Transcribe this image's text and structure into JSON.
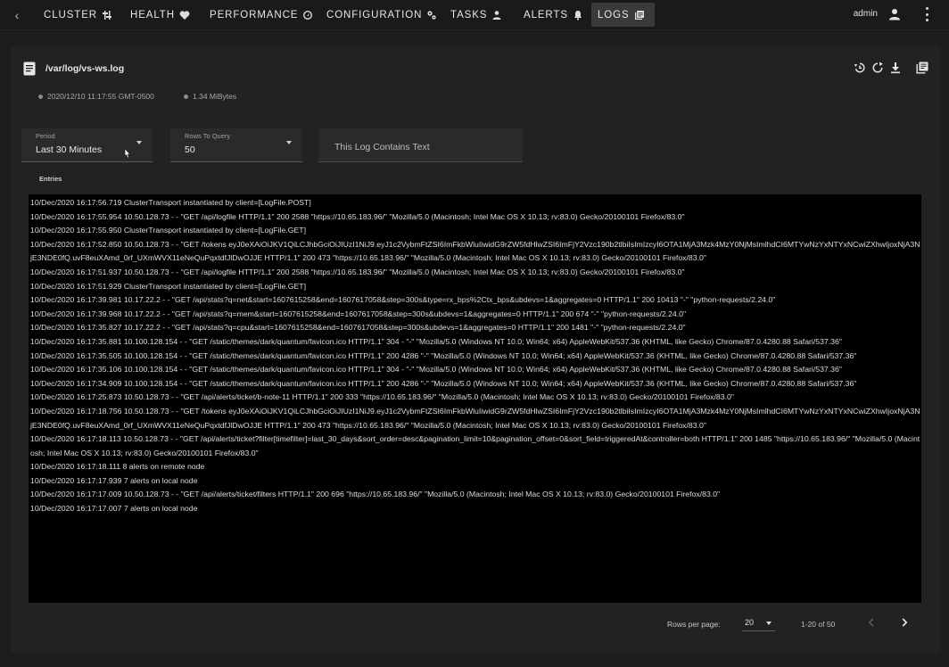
{
  "nav": {
    "items": [
      {
        "label": "CLUSTER",
        "icon": "cluster-icon"
      },
      {
        "label": "HEALTH",
        "icon": "heart-icon"
      },
      {
        "label": "PERFORMANCE",
        "icon": "speedometer-icon"
      },
      {
        "label": "CONFIGURATION",
        "icon": "gears-icon"
      },
      {
        "label": "TASKS",
        "icon": "task-person-icon"
      },
      {
        "label": "ALERTS",
        "icon": "bell-icon"
      },
      {
        "label": "LOGS",
        "icon": "logs-icon"
      }
    ],
    "active": "LOGS",
    "user": "admin"
  },
  "file": {
    "path": "/var/log/vs-ws.log",
    "timestamp": "2020/12/10 11:17:55 GMT-0500",
    "size": "1.34 MiBytes"
  },
  "filters": {
    "period_label": "Period",
    "period_value": "Last 30 Minutes",
    "rows_label": "Rows To Query",
    "rows_value": "50",
    "search_placeholder": "This Log Contains Text"
  },
  "entries_label": "Entries",
  "log_lines": [
    "10/Dec/2020 16:17:56.719 ClusterTransport instantiated by client=[LogFile.POST]",
    "10/Dec/2020 16:17:55.954 10.50.128.73 - - \"GET /api/logfile HTTP/1.1\" 200 2588 \"https://10.65.183.96/\" \"Mozilla/5.0 (Macintosh; Intel Mac OS X 10.13; rv:83.0) Gecko/20100101 Firefox/83.0\"",
    "10/Dec/2020 16:17:55.950 ClusterTransport instantiated by client=[LogFile.GET]",
    "10/Dec/2020 16:17:52.850 10.50.128.73 - - \"GET /tokens eyJ0eXAiOiJKV1QiLCJhbGciOiJIUzI1NiJ9.eyJ1c2VybmFtZSI6ImFkbWluIiwidG9rZW5fdHlwZSI6ImFjY2Vzc190b2tlbiIsImIzcyI6OTA1MjA3Mzk4MzY0NjMsImlhdCI6MTYwNzYxNTYxNCwiZXhwIjoxNjA3NjE3NDE0fQ.uvF8euXAmd_0rf_UXmWVX11eNeQuPqxtdfJlDwOJJE HTTP/1.1\" 200 473 \"https://10.65.183.96/\" \"Mozilla/5.0 (Macintosh; Intel Mac OS X 10.13; rv:83.0) Gecko/20100101 Firefox/83.0\"",
    "10/Dec/2020 16:17:51.937 10.50.128.73 - - \"GET /api/logfile HTTP/1.1\" 200 2588 \"https://10.65.183.96/\" \"Mozilla/5.0 (Macintosh; Intel Mac OS X 10.13; rv:83.0) Gecko/20100101 Firefox/83.0\"",
    "10/Dec/2020 16:17:51.929 ClusterTransport instantiated by client=[LogFile.GET]",
    "10/Dec/2020 16:17:39.981 10.17.22.2 - - \"GET /api/stats?q=net&start=1607615258&end=1607617058&step=300s&type=rx_bps%2Ctx_bps&ubdevs=1&aggregates=0 HTTP/1.1\" 200 10413 \"-\" \"python-requests/2.24.0\"",
    "10/Dec/2020 16:17:39.968 10.17.22.2 - - \"GET /api/stats?q=mem&start=1607615258&end=1607617058&step=300s&ubdevs=1&aggregates=0 HTTP/1.1\" 200 674 \"-\" \"python-requests/2.24.0\"",
    "10/Dec/2020 16:17:35.827 10.17.22.2 - - \"GET /api/stats?q=cpu&start=1607615258&end=1607617058&step=300s&ubdevs=1&aggregates=0 HTTP/1.1\" 200 1481 \"-\" \"python-requests/2.24.0\"",
    "10/Dec/2020 16:17:35.881 10.100.128.154 - - \"GET /static/themes/dark/quantum/favicon.ico HTTP/1.1\" 304 - \"-\" \"Mozilla/5.0 (Windows NT 10.0; Win64; x64) AppleWebKit/537.36 (KHTML, like Gecko) Chrome/87.0.4280.88 Safari/537.36\"",
    "10/Dec/2020 16:17:35.505 10.100.128.154 - - \"GET /static/themes/dark/quantum/favicon.ico HTTP/1.1\" 200 4286 \"-\" \"Mozilla/5.0 (Windows NT 10.0; Win64; x64) AppleWebKit/537.36 (KHTML, like Gecko) Chrome/87.0.4280.88 Safari/537.36\"",
    "10/Dec/2020 16:17:35.106 10.100.128.154 - - \"GET /static/themes/dark/quantum/favicon.ico HTTP/1.1\" 304 - \"-\" \"Mozilla/5.0 (Windows NT 10.0; Win64; x64) AppleWebKit/537.36 (KHTML, like Gecko) Chrome/87.0.4280.88 Safari/537.36\"",
    "10/Dec/2020 16:17:34.909 10.100.128.154 - - \"GET /static/themes/dark/quantum/favicon.ico HTTP/1.1\" 200 4286 \"-\" \"Mozilla/5.0 (Windows NT 10.0; Win64; x64) AppleWebKit/537.36 (KHTML, like Gecko) Chrome/87.0.4280.88 Safari/537.36\"",
    "10/Dec/2020 16:17:25.873 10.50.128.73 - - \"GET /api/alerts/ticket/b-note-11 HTTP/1.1\" 200 333 \"https://10.65.183.96/\" \"Mozilla/5.0 (Macintosh; Intel Mac OS X 10.13; rv:83.0) Gecko/20100101 Firefox/83.0\"",
    "10/Dec/2020 16:17:18.756 10.50.128.73 - - \"GET /tokens eyJ0eXAiOiJKV1QiLCJhbGciOiJIUzI1NiJ9.eyJ1c2VybmFtZSI6ImFkbWluIiwidG9rZW5fdHlwZSI6ImFjY2Vzc190b2tlbiIsImIzcyI6OTA1MjA3Mzk4MzY0NjMsImlhdCI6MTYwNzYxNTYxNCwiZXhwIjoxNjA3NjE3NDE0fQ.uvF8euXAmd_0rf_UXmWVX11eNeQuPqxtdfJlDwOJJE HTTP/1.1\" 200 473 \"https://10.65.183.96/\" \"Mozilla/5.0 (Macintosh; Intel Mac OS X 10.13; rv:83.0) Gecko/20100101 Firefox/83.0\"",
    "10/Dec/2020 16:17:18.113 10.50.128.73 - - \"GET /api/alerts/ticket?filter[timefilter]=last_30_days&sort_order=desc&pagination_limit=10&pagination_offset=0&sort_field=triggeredAt&controller=both HTTP/1.1\" 200 1485 \"https://10.65.183.96/\" \"Mozilla/5.0 (Macintosh; Intel Mac OS X 10.13; rv:83.0) Gecko/20100101 Firefox/83.0\"",
    "10/Dec/2020 16:17:18.111 8 alerts on remote node",
    "10/Dec/2020 16:17:17.939 7 alerts on local node",
    "10/Dec/2020 16:17:17.009 10.50.128.73 - - \"GET /api/alerts/ticket/filters HTTP/1.1\" 200 696 \"https://10.65.183.96/\" \"Mozilla/5.0 (Macintosh; Intel Mac OS X 10.13; rv:83.0) Gecko/20100101 Firefox/83.0\"",
    "10/Dec/2020 16:17:17.007 7 alerts on local node"
  ],
  "pagination": {
    "rows_per_page_label": "Rows per page:",
    "rows_per_page_value": "20",
    "range": "1-20 of 50"
  }
}
